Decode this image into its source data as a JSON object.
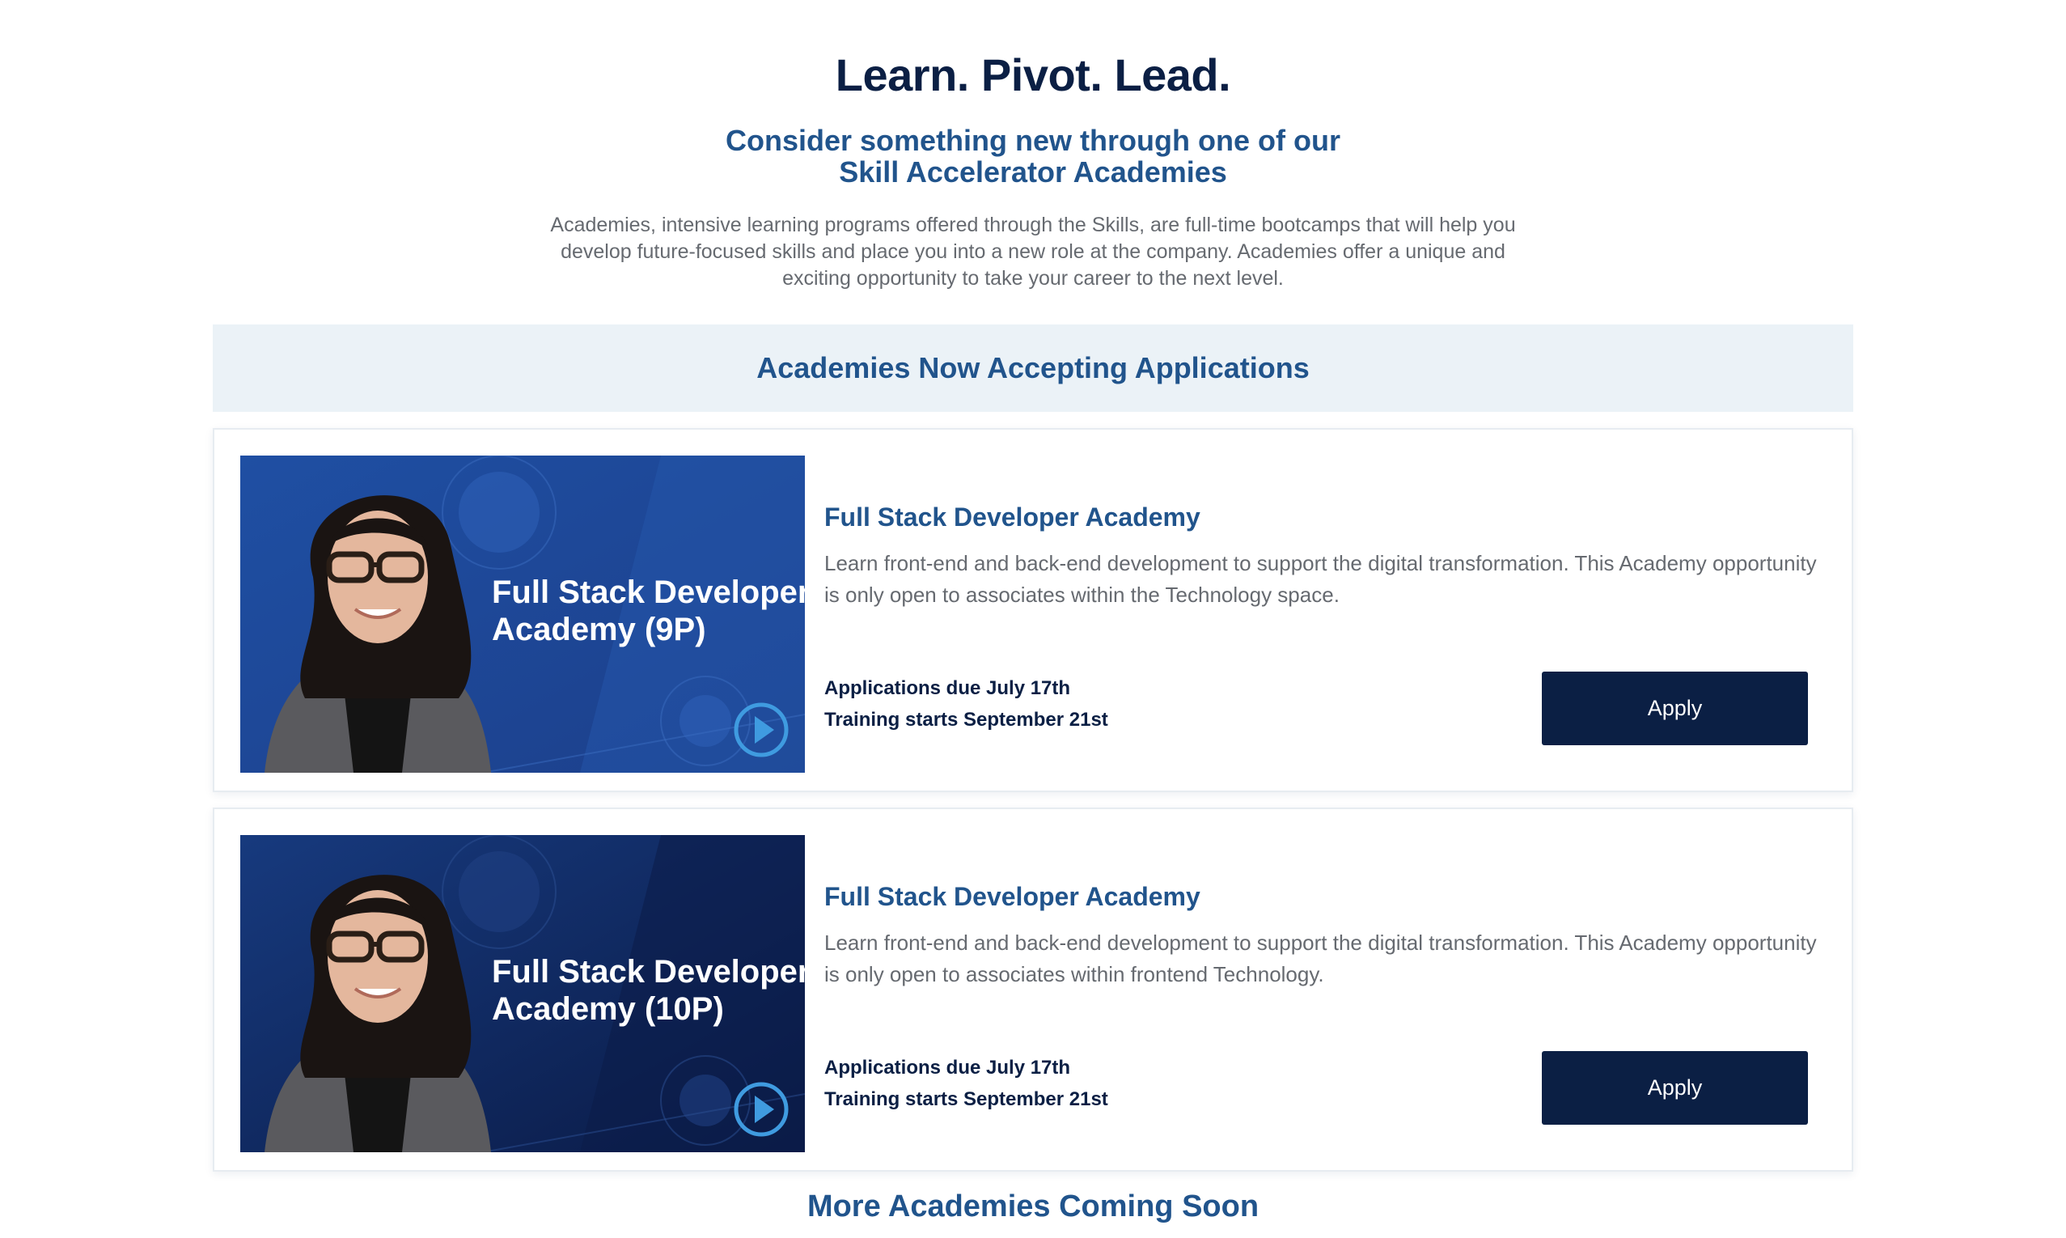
{
  "hero": {
    "title": "Learn. Pivot. Lead.",
    "subtitle_line1": "Consider something new through one of our",
    "subtitle_line2": "Skill Accelerator Academies",
    "description": "Academies, intensive learning programs offered through the Skills, are full-time bootcamps that will help you develop future-focused skills and place you into a new role at the company. Academies offer a unique and exciting opportunity to take your career to the next level."
  },
  "section": {
    "title": "Academies Now Accepting Applications"
  },
  "academies": [
    {
      "thumbnail_line1": "Full Stack Developer",
      "thumbnail_line2": "Academy (9P)",
      "title": "Full Stack Developer Academy",
      "description": "Learn front-end and back-end development to support the digital transformation. This Academy opportunity is only open to associates within the Technology space.",
      "applications_due": "Applications due July 17th",
      "training_starts": "Training starts September 21st",
      "apply_label": "Apply"
    },
    {
      "thumbnail_line1": "Full Stack Developer",
      "thumbnail_line2": "Academy (10P)",
      "title": "Full Stack Developer Academy",
      "description": "Learn front-end and back-end development to support the digital transformation. This Academy opportunity is only open to associates within frontend Technology.",
      "applications_due": "Applications due July 17th",
      "training_starts": "Training starts September 21st",
      "apply_label": "Apply"
    }
  ],
  "footer": {
    "coming_soon": "More Academies Coming Soon"
  },
  "colors": {
    "navy": "#0b1f44",
    "accent_blue": "#21548c",
    "band_bg": "#ebf2f7",
    "play_icon": "#3f9be0"
  }
}
